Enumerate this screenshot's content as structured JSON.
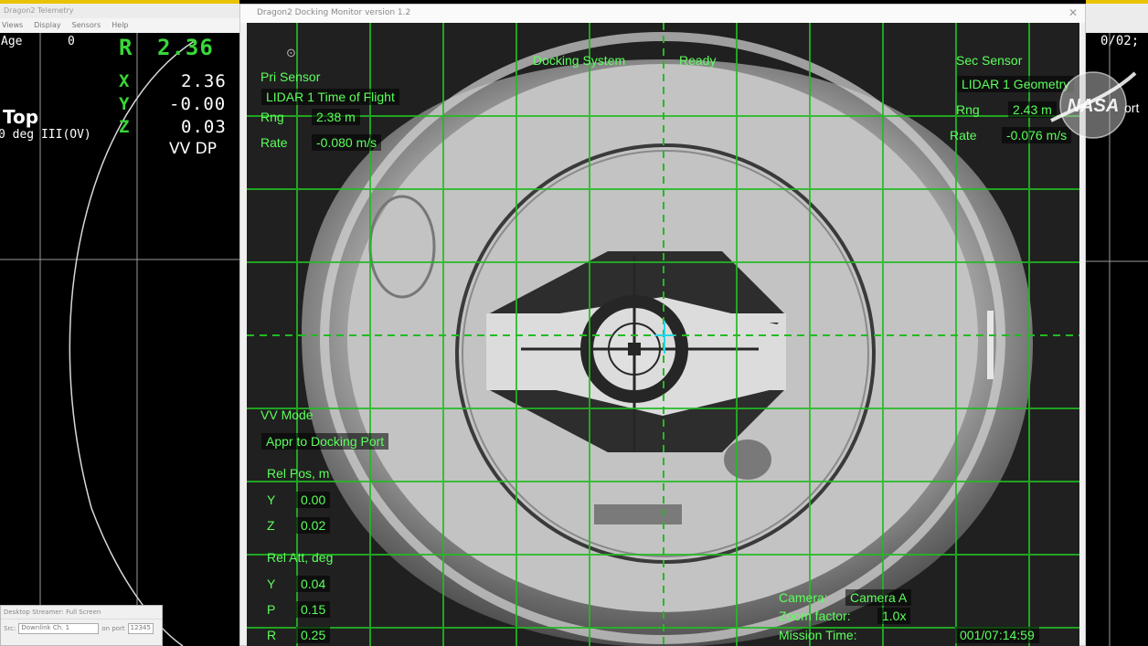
{
  "left_window": {
    "title": "Dragon2 Telemetry",
    "menu": [
      "Views",
      "Display",
      "Sensors",
      "Help"
    ],
    "telemetry": {
      "age_label": "Age",
      "age_value": "0",
      "r_label": "R",
      "r_value": "2.36",
      "x_label": "X",
      "x_value": "2.36",
      "y_label": "Y",
      "y_value": "-0.00",
      "z_label": "Z",
      "z_value": "0.03",
      "view_label": "Top",
      "view_sub": "0 deg III(OV)",
      "frame_label": "VV DP"
    },
    "stream_dialog": {
      "title": "Desktop Streamer: Full Screen",
      "field_label": "Src:",
      "select_value": "Downlink Ch. 1",
      "port_label": "on port",
      "port_value": "12345"
    }
  },
  "main_window": {
    "title": "Dragon2 Docking Monitor version 1.2",
    "close_glyph": "✕",
    "hud": {
      "pri_sensor_label": "Pri Sensor",
      "pri_sensor_name": "LIDAR 1 Time of Flight",
      "pri_rng_label": "Rng",
      "pri_rng_value": "2.38 m",
      "pri_rate_label": "Rate",
      "pri_rate_value": "-0.080 m/s",
      "docking_system_label": "Docking System",
      "docking_system_status": "Ready",
      "sec_sensor_label": "Sec Sensor",
      "sec_sensor_name": "LIDAR 1 Geometry",
      "sec_rng_label": "Rng",
      "sec_rng_value": "2.43 m",
      "sec_rate_label": "Rate",
      "sec_rate_value": "-0.076 m/s",
      "vv_mode_label": "VV Mode",
      "vv_mode_value": "Appr to Docking Port",
      "rel_pos_label": "Rel Pos, m",
      "rel_pos_y_label": "Y",
      "rel_pos_y_value": "0.00",
      "rel_pos_z_label": "Z",
      "rel_pos_z_value": "0.02",
      "rel_att_label": "Rel Att, deg",
      "rel_att_y_label": "Y",
      "rel_att_y_value": "0.04",
      "rel_att_p_label": "P",
      "rel_att_p_value": "0.15",
      "rel_att_r_label": "R",
      "rel_att_r_value": "0.25",
      "camera_label": "Camera:",
      "camera_value": "Camera A",
      "zoom_label": "Zoom factor:",
      "zoom_value": "1.0x",
      "mission_time_label": "Mission Time:",
      "mission_time_value": "001/07:14:59"
    }
  },
  "right_window": {
    "clock": "0/02;",
    "port_text": "ort"
  },
  "logo": {
    "text": "NASA"
  },
  "colors": {
    "hud_green": "#5cff5c",
    "grid_green": "#22bb22",
    "telemetry_green": "#38d838",
    "window_chrome": "#f0f0f0",
    "accent_yellow": "#e8c400"
  }
}
